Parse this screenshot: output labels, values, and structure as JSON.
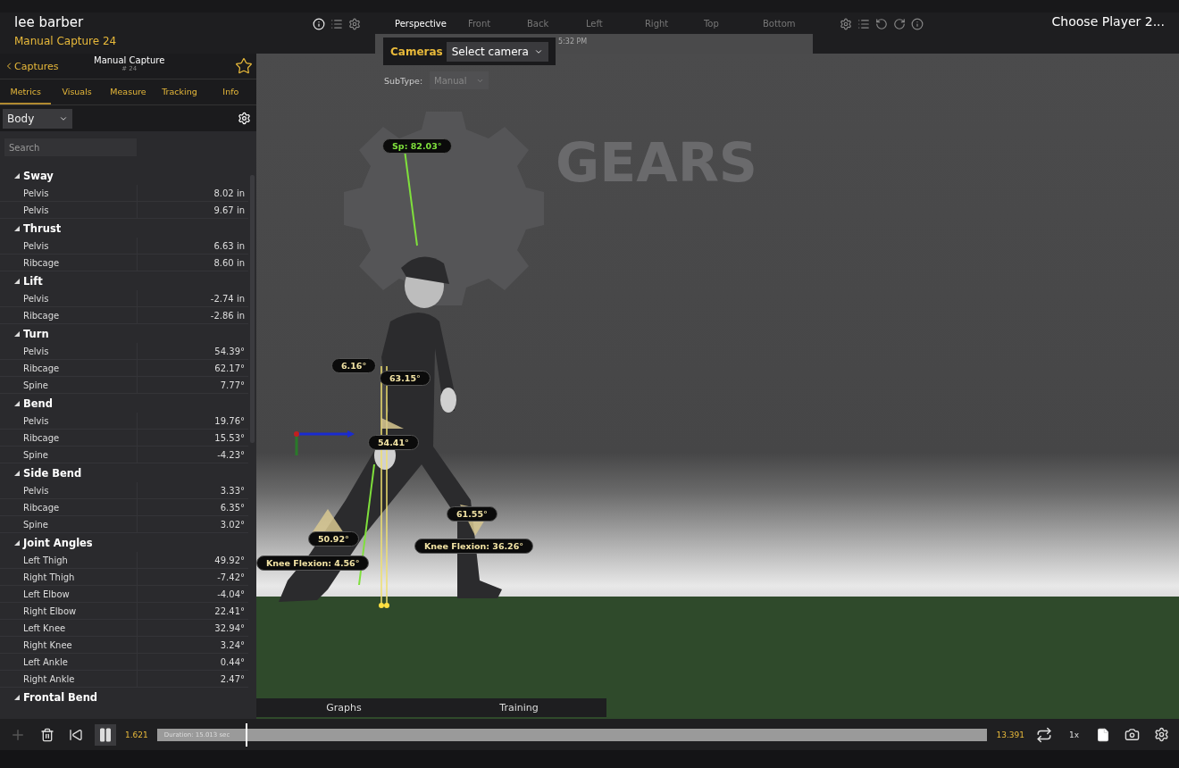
{
  "header": {
    "user": "lee barber",
    "capture": "Manual Capture 24",
    "right_title": "Choose Player 2..."
  },
  "view_tabs": [
    {
      "label": "Perspective",
      "selected": true
    },
    {
      "label": "Front",
      "selected": false
    },
    {
      "label": "Back",
      "selected": false
    },
    {
      "label": "Left",
      "selected": false
    },
    {
      "label": "Right",
      "selected": false
    },
    {
      "label": "Top",
      "selected": false
    },
    {
      "label": "Bottom",
      "selected": false
    }
  ],
  "time": "5:32 PM",
  "cameras": {
    "label": "Cameras",
    "value": "Select camera"
  },
  "subtype": {
    "label": "SubType:",
    "value": "Manual"
  },
  "panel": {
    "back": "Captures",
    "title": "Manual Capture",
    "subtitle": "# 24",
    "favorite": false,
    "tabs": [
      {
        "label": "Metrics",
        "selected": true
      },
      {
        "label": "Visuals",
        "selected": false
      },
      {
        "label": "Measure",
        "selected": false
      },
      {
        "label": "Tracking",
        "selected": false
      },
      {
        "label": "Info",
        "selected": false
      }
    ],
    "filter": "Body",
    "search_placeholder": "Search",
    "groups": [
      {
        "name": "Sway",
        "expanded": true,
        "rows": [
          {
            "label": "Pelvis",
            "value": "8.02 in"
          },
          {
            "label": "Pelvis",
            "value": "9.67 in"
          }
        ]
      },
      {
        "name": "Thrust",
        "expanded": true,
        "rows": [
          {
            "label": "Pelvis",
            "value": "6.63 in"
          },
          {
            "label": "Ribcage",
            "value": "8.60 in"
          }
        ]
      },
      {
        "name": "Lift",
        "expanded": true,
        "rows": [
          {
            "label": "Pelvis",
            "value": "-2.74 in"
          },
          {
            "label": "Ribcage",
            "value": "-2.86 in"
          }
        ]
      },
      {
        "name": "Turn",
        "expanded": true,
        "rows": [
          {
            "label": "Pelvis",
            "value": "54.39°"
          },
          {
            "label": "Ribcage",
            "value": "62.17°"
          },
          {
            "label": "Spine",
            "value": "7.77°"
          }
        ]
      },
      {
        "name": "Bend",
        "expanded": true,
        "rows": [
          {
            "label": "Pelvis",
            "value": "19.76°"
          },
          {
            "label": "Ribcage",
            "value": "15.53°"
          },
          {
            "label": "Spine",
            "value": "-4.23°"
          }
        ]
      },
      {
        "name": "Side Bend",
        "expanded": true,
        "rows": [
          {
            "label": "Pelvis",
            "value": "3.33°"
          },
          {
            "label": "Ribcage",
            "value": "6.35°"
          },
          {
            "label": "Spine",
            "value": "3.02°"
          }
        ]
      },
      {
        "name": "Joint Angles",
        "expanded": true,
        "rows": [
          {
            "label": "Left Thigh",
            "value": "49.92°"
          },
          {
            "label": "Right Thigh",
            "value": "-7.42°"
          },
          {
            "label": "Left Elbow",
            "value": "-4.04°"
          },
          {
            "label": "Right Elbow",
            "value": "22.41°"
          },
          {
            "label": "Left Knee",
            "value": "32.94°"
          },
          {
            "label": "Right Knee",
            "value": "3.24°"
          },
          {
            "label": "Left Ankle",
            "value": "0.44°"
          },
          {
            "label": "Right Ankle",
            "value": "2.47°"
          }
        ]
      },
      {
        "name": "Frontal Bend",
        "expanded": true
      }
    ]
  },
  "scene": {
    "logo": "GEARS",
    "labels": [
      {
        "text": "Sp: 82.03°",
        "kind": "spine"
      },
      {
        "text": "6.16°",
        "kind": "joint"
      },
      {
        "text": "63.15°",
        "kind": "joint"
      },
      {
        "text": "54.41°",
        "kind": "joint"
      },
      {
        "text": "61.55°",
        "kind": "joint"
      },
      {
        "text": "50.92°",
        "kind": "joint"
      },
      {
        "text": "Knee Flexion: 36.26°",
        "kind": "joint"
      },
      {
        "text": "Knee Flexion: 4.56°",
        "kind": "joint"
      }
    ]
  },
  "bottom_tabs": [
    {
      "label": "Graphs"
    },
    {
      "label": "Training"
    }
  ],
  "timeline": {
    "current": "1.621",
    "duration": "Duration: 15.013 sec",
    "end": "13.391",
    "level": 0.107,
    "speed": "1x",
    "playing": true
  }
}
